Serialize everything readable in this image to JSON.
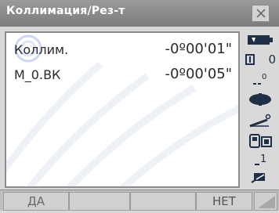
{
  "window": {
    "title": "Коллимация/Рез-т"
  },
  "results": [
    {
      "label": "Коллим.",
      "value": "-0º00'01\""
    },
    {
      "label": "M_0.ВК",
      "value": "-0º00'05\""
    }
  ],
  "sidebar": {
    "icons": [
      "battery-icon",
      "distance-mode-icon",
      "prism-constant-icon",
      "target-icon",
      "tilt-icon",
      "memory-card-icon",
      "page-number-icon",
      "pencil-icon"
    ],
    "distance_mode_text": "0",
    "prism_constant_text": "0",
    "page_number": "1"
  },
  "softkeys": [
    {
      "label": "ДА"
    },
    {
      "label": ""
    },
    {
      "label": ""
    },
    {
      "label": "НЕТ"
    }
  ],
  "colors": {
    "titlebar": "#888888",
    "background": "#d9d9d9",
    "panel": "#ffffff"
  }
}
